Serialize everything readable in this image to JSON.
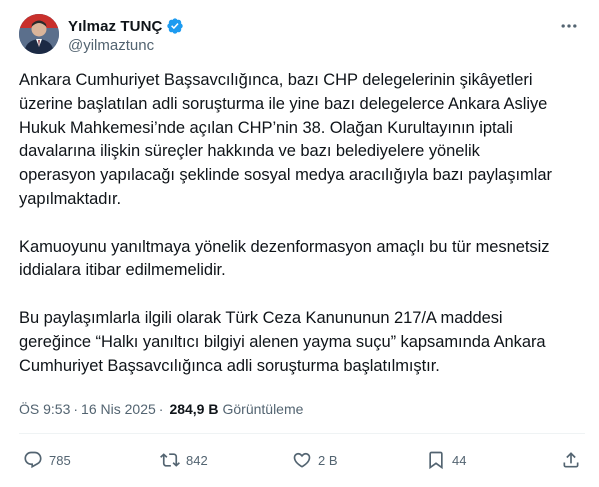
{
  "author": {
    "name": "Yılmaz TUNÇ",
    "handle": "@yilmaztunc",
    "verified": true,
    "avatar_icon": "profile-photo"
  },
  "tweet": {
    "paragraphs": [
      "Ankara Cumhuriyet Başsavcılığınca, bazı CHP delegelerinin şikâyetleri\nüzerine başlatılan adli soruşturma ile yine bazı delegelerce Ankara Asliye\nHukuk Mahkemesi’nde açılan CHP’nin 38. Olağan Kurultayının iptali\ndavalarına ilişkin süreçler hakkında ve bazı belediyelere yönelik\noperasyon yapılacağı şeklinde sosyal medya aracılığıyla bazı paylaşımlar\nyapılmaktadır.",
      "Kamuoyunu yanıltmaya yönelik dezenformasyon amaçlı bu tür mesnetsiz\niddialara itibar edilmemelidir.",
      "Bu paylaşımlarla ilgili olarak Türk Ceza Kanununun 217/A maddesi\ngereğince “Halkı yanıltıcı bilgiyi alenen yayma suçu” kapsamında Ankara\nCumhuriyet Başsavcılığınca adli soruşturma başlatılmıştır."
    ]
  },
  "meta": {
    "time": "ÖS 9:53",
    "separator": "·",
    "date": "16 Nis 2025",
    "views": "284,9 B",
    "views_label": "Görüntüleme"
  },
  "actions": {
    "replies": "785",
    "reposts": "842",
    "likes": "2 B",
    "bookmarks": "44"
  },
  "colors": {
    "text": "#0f1419",
    "secondary": "#536471",
    "verified": "#1d9bf0",
    "divider": "#eff3f4"
  }
}
